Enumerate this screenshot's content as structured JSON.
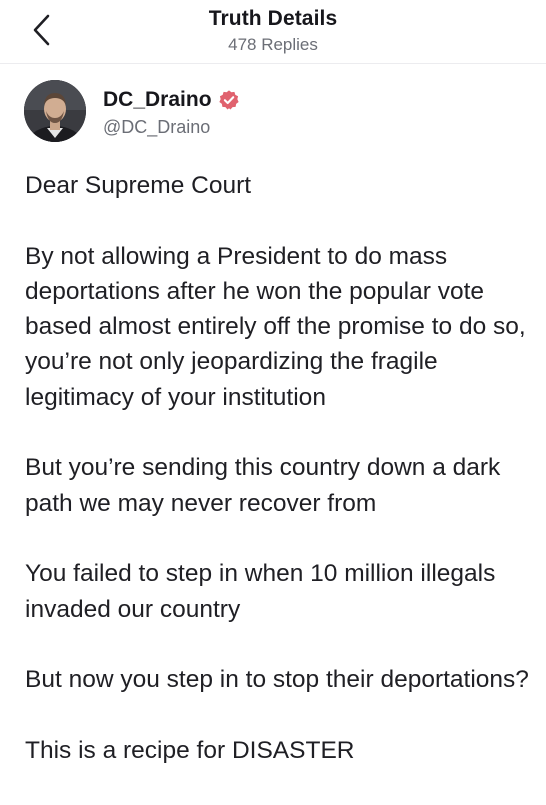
{
  "header": {
    "back_icon": "chevron-left-icon",
    "title": "Truth Details",
    "subtitle": "478 Replies"
  },
  "author": {
    "display_name": "DC_Draino",
    "handle": "@DC_Draino",
    "verified_icon": "verified-badge-icon",
    "verified_color": "#e0626e"
  },
  "post": {
    "paragraphs": [
      "Dear Supreme Court",
      "By not allowing a President to do mass deportations after he won the popular vote based almost entirely off the promise to do so, you’re not only jeopardizing the fragile legitimacy of your institution",
      "But you’re sending this country down a dark path we may never recover from",
      "You failed to step in when 10 million illegals invaded our country",
      "But now you step in to stop their deportations?",
      "This is a recipe for DISASTER"
    ]
  }
}
